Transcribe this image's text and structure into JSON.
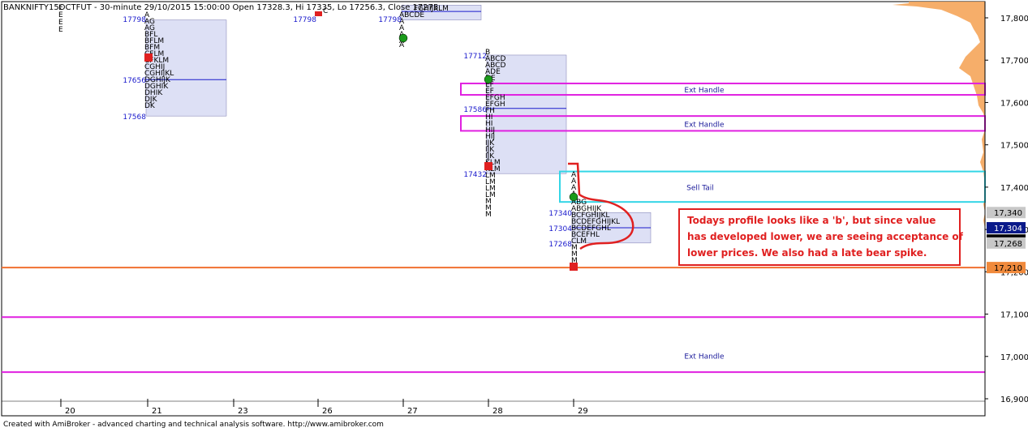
{
  "header": {
    "title": "BANKNIFTY15OCTFUT - 30-minute 29/10/2015 15:00:00 Open 17328.3, Hi 17335, Lo 17256.3, Close 17275"
  },
  "footer": {
    "credit": "Created with AmiBroker - advanced charting and technical analysis software. http://www.amibroker.com"
  },
  "chart_data": {
    "type": "market-profile",
    "symbol": "BANKNIFTY15OCTFUT",
    "timeframe": "30-minute",
    "ylim": [
      16860,
      17880
    ],
    "y_ticks": [
      16900,
      17000,
      17100,
      17200,
      17300,
      17400,
      17500,
      17600,
      17700,
      17800
    ],
    "y_tick_labels": [
      "16,900",
      "17,000",
      "17,100",
      "17,200",
      "17,300",
      "17,400",
      "17,500",
      "17,600",
      "17,700",
      "17,800"
    ],
    "x_dates": [
      "20",
      "21",
      "23",
      "26",
      "27",
      "28",
      "29"
    ],
    "ohlc_last": {
      "open": 17328.3,
      "high": 17335,
      "low": 17256.3,
      "close": 17275
    },
    "price_badges": [
      {
        "label": "17,340",
        "value": 17340,
        "color": "#c8c8c8",
        "text_color": "#000000"
      },
      {
        "label": "17,304",
        "value": 17304,
        "color": "#0a1a8a",
        "text_color": "#ffffff"
      },
      {
        "label": "17,275",
        "value": 17275,
        "color": "#000000",
        "text_color": "#ffffff"
      },
      {
        "label": "17,268",
        "value": 17268,
        "color": "#c8c8c8",
        "text_color": "#000000"
      },
      {
        "label": "17,210",
        "value": 17210,
        "color": "#f08a3c",
        "text_color": "#000000"
      }
    ],
    "profile_price_labels": [
      {
        "text": "17798",
        "day": "21",
        "value": 17798
      },
      {
        "text": "17656",
        "day": "21",
        "value": 17654
      },
      {
        "text": "17568",
        "day": "21",
        "value": 17568
      },
      {
        "text": "17798",
        "day": "26",
        "value": 17798
      },
      {
        "text": "17798",
        "day": "27",
        "value": 17798
      },
      {
        "text": "17712",
        "day": "28",
        "value": 17712
      },
      {
        "text": "17586",
        "day": "28",
        "value": 17586
      },
      {
        "text": "17432",
        "day": "28",
        "value": 17432
      },
      {
        "text": "17340",
        "day": "29",
        "value": 17340
      },
      {
        "text": "17304",
        "day": "29",
        "value": 17304
      },
      {
        "text": "17268",
        "day": "29",
        "value": 17268
      }
    ],
    "value_areas": [
      {
        "day": "21",
        "low": 17568,
        "high": 17795,
        "poc": 17654
      },
      {
        "day": "27",
        "low": 17795,
        "high": 17830,
        "poc": 17815
      },
      {
        "day": "28",
        "low": 17432,
        "high": 17712,
        "poc": 17586
      },
      {
        "day": "29",
        "low": 17268,
        "high": 17340,
        "poc": 17304
      }
    ],
    "zones": [
      {
        "label": "Ext Handle",
        "low": 17618,
        "high": 17645,
        "color": "#e020e0"
      },
      {
        "label": "Ext Handle",
        "low": 17533,
        "high": 17568,
        "color": "#e020e0"
      },
      {
        "label": "Sell Tail",
        "low": 17365,
        "high": 17437,
        "color": "#33d6e6"
      }
    ],
    "lines": [
      {
        "label": "",
        "value": 17210,
        "color": "#f07030"
      },
      {
        "label": "",
        "value": 17093,
        "color": "#e020e0"
      },
      {
        "label": "Ext Handle",
        "value": 16963,
        "color": "#e020e0"
      }
    ],
    "annotation": {
      "text_lines": [
        "Todays profile looks like a 'b', but since value",
        "has developed lower, we are seeing acceptance of",
        "lower prices. We also had a late bear spike."
      ],
      "color": "#e02020"
    }
  }
}
